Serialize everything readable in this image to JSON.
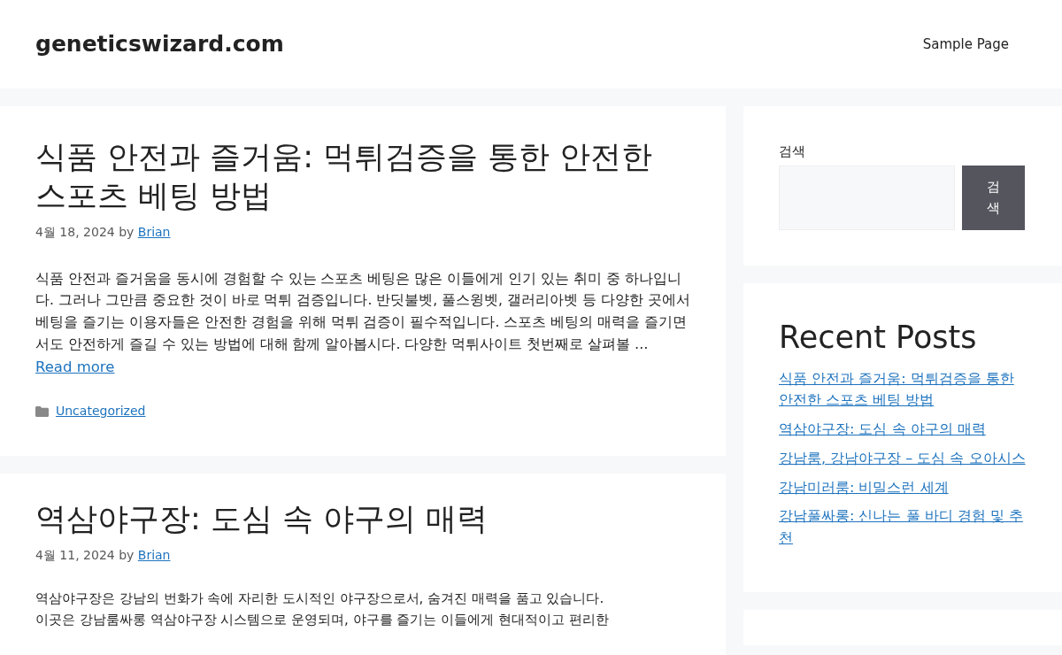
{
  "site_title": "geneticswizard.com",
  "nav": [
    {
      "label": "Sample Page"
    }
  ],
  "posts": [
    {
      "title": "식품 안전과 즐거움: 먹튀검증을 통한 안전한 스포츠 베팅 방법",
      "date": "4월 18, 2024",
      "by": "by",
      "author": "Brian",
      "excerpt": "식품 안전과 즐거움을 동시에 경험할 수 있는 스포츠 베팅은 많은 이들에게 인기 있는 취미 중 하나입니다. 그러나 그만큼 중요한 것이 바로 먹튀 검증입니다. 반딧불벳, 풀스윙벳, 갤러리아벳 등 다양한 곳에서 베팅을 즐기는 이용자들은 안전한 경험을 위해 먹튀 검증이 필수적입니다. 스포츠 베팅의 매력을 즐기면서도 안전하게 즐길 수 있는 방법에 대해 함께 알아봅시다. 다양한 먹튀사이트 첫번째로 살펴볼 …",
      "read_more": "Read more",
      "category": "Uncategorized"
    },
    {
      "title": "역삼야구장: 도심 속 야구의 매력",
      "date": "4월 11, 2024",
      "by": "by",
      "author": "Brian",
      "excerpt_lines": [
        "역삼야구장은 강남의 번화가 속에 자리한 도시적인 야구장으로서, 숨겨진 매력을 품고 있습니다.",
        "이곳은 강남룸싸롱 역삼야구장 시스템으로 운영되며, 야구를 즐기는 이들에게 현대적이고 편리한"
      ]
    }
  ],
  "search": {
    "label": "검색",
    "button": "검색"
  },
  "recent_posts": {
    "title": "Recent Posts",
    "items": [
      "식품 안전과 즐거움: 먹튀검증을 통한 안전한 스포츠 베팅 방법",
      "역삼야구장: 도심 속 야구의 매력",
      "강남룸, 강남야구장 – 도심 속 오아시스",
      "강남미러룸: 비밀스런 세계",
      "강남풀싸롱: 신나는 풀 바디 경험 및 추천"
    ]
  }
}
